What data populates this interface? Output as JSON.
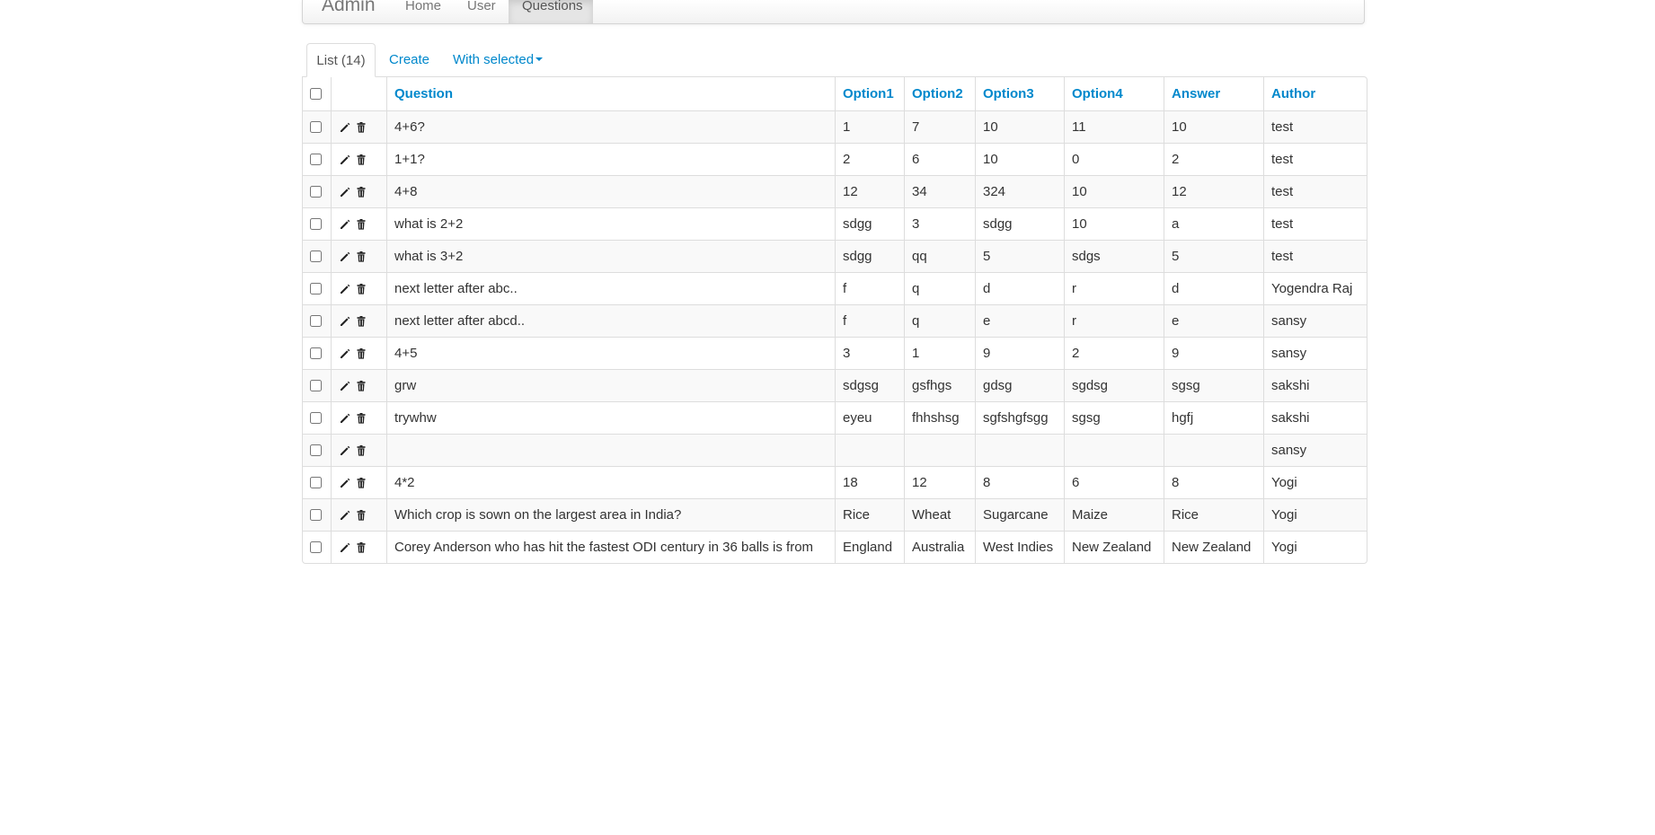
{
  "navbar": {
    "brand": "Admin",
    "items": [
      {
        "label": "Home"
      },
      {
        "label": "User"
      },
      {
        "label": "Questions",
        "active": true
      }
    ]
  },
  "tabs": {
    "list_label": "List (14)",
    "create_label": "Create",
    "with_selected_label": "With selected"
  },
  "table": {
    "columns": [
      "Question",
      "Option1",
      "Option2",
      "Option3",
      "Option4",
      "Answer",
      "Author"
    ],
    "rows": [
      [
        "4+6?",
        "1",
        "7",
        "10",
        "11",
        "10",
        "test"
      ],
      [
        "1+1?",
        "2",
        "6",
        "10",
        "0",
        "2",
        "test"
      ],
      [
        "4+8",
        "12",
        "34",
        "324",
        "10",
        "12",
        "test"
      ],
      [
        "what is 2+2",
        "sdgg",
        "3",
        "sdgg",
        "10",
        "a",
        "test"
      ],
      [
        "what is 3+2",
        "sdgg",
        "qq",
        "5",
        "sdgs",
        "5",
        "test"
      ],
      [
        "next letter after abc..",
        "f",
        "q",
        "d",
        "r",
        "d",
        "Yogendra Raj"
      ],
      [
        "next letter after abcd..",
        "f",
        "q",
        "e",
        "r",
        "e",
        "sansy"
      ],
      [
        "4+5",
        "3",
        "1",
        "9",
        "2",
        "9",
        "sansy"
      ],
      [
        "grw",
        "sdgsg",
        "gsfhgs",
        "gdsg",
        "sgdsg",
        "sgsg",
        "sakshi"
      ],
      [
        "trywhw",
        "eyeu",
        "fhhshsg",
        "sgfshgfsgg",
        "sgsg",
        "hgfj",
        "sakshi"
      ],
      [
        "",
        "",
        "",
        "",
        "",
        "",
        "sansy"
      ],
      [
        "4*2",
        "18",
        "12",
        "8",
        "6",
        "8",
        "Yogi"
      ],
      [
        "Which crop is sown on the largest area in India?",
        "Rice",
        "Wheat",
        "Sugarcane",
        "Maize",
        "Rice",
        "Yogi"
      ],
      [
        "Corey Anderson who has hit the fastest ODI century in 36 balls is from",
        "England",
        "Australia",
        "West Indies",
        "New Zealand",
        "New Zealand",
        "Yogi"
      ]
    ]
  },
  "colors": {
    "link": "#0088cc",
    "text": "#333333",
    "border": "#dddddd",
    "stripe": "#f9f9f9"
  },
  "icons": {
    "edit": "pencil-icon",
    "delete": "trash-icon"
  }
}
